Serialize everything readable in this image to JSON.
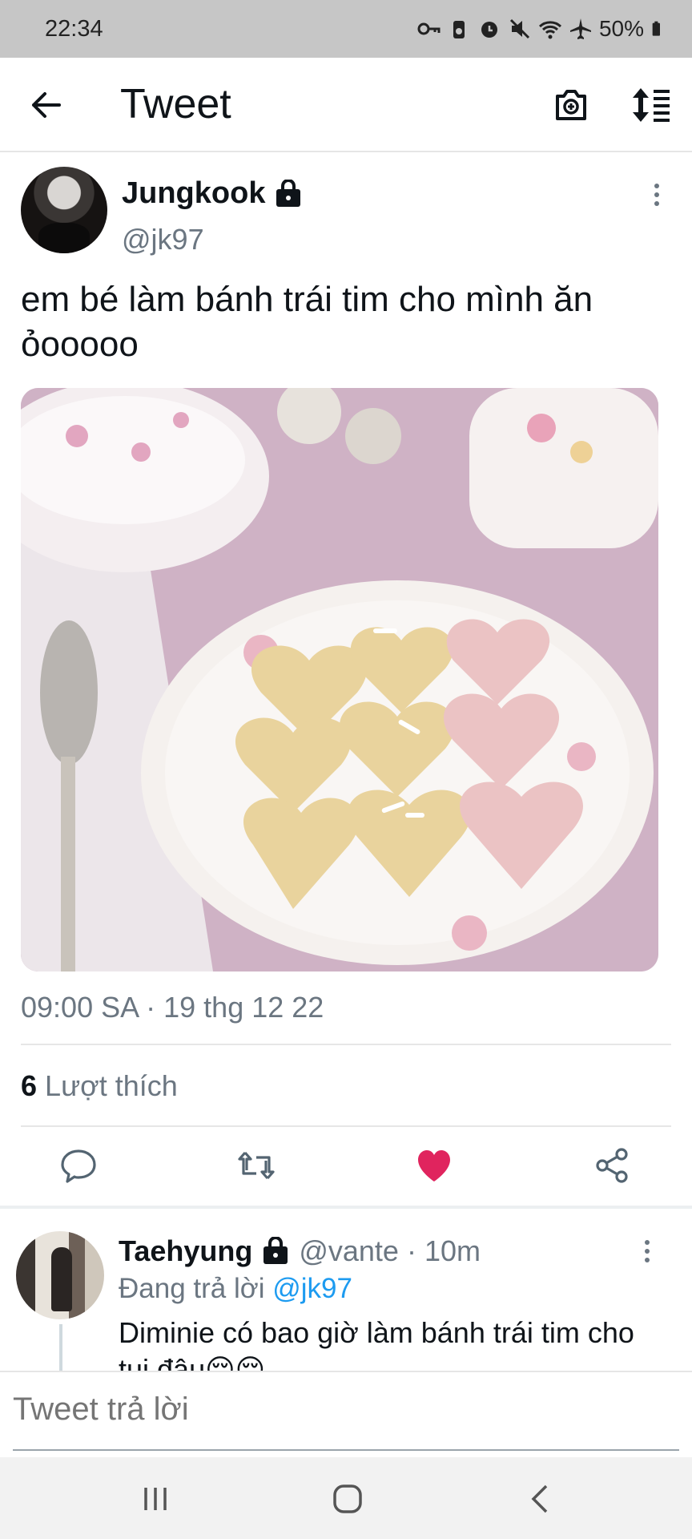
{
  "status_bar": {
    "time": "22:34",
    "battery": "50%",
    "icons": [
      "key-icon",
      "battery-saver-icon",
      "alarm-icon",
      "mute-icon",
      "wifi-icon",
      "airplane-icon",
      "battery-icon"
    ]
  },
  "header": {
    "title": "Tweet",
    "icons": [
      "back-arrow-icon",
      "camera-icon",
      "sort-icon"
    ]
  },
  "tweet": {
    "author_name": "Jungkook",
    "author_handle": "@jk97",
    "protected": true,
    "text": "em bé làm bánh trái tim cho mình ăn ỏooooo",
    "image_description_icon": "heart-cookies-photo",
    "timestamp": "09:00 SA · 19 thg 12 22",
    "likes_count": "6",
    "likes_label": "Lượt thích",
    "liked": true,
    "accent_color": "#e0245e"
  },
  "reply": {
    "author_name": "Taehyung",
    "protected": true,
    "meta": "@vante · 10m",
    "replying_prefix": "Đang trả lời",
    "replying_to": "@jk97",
    "text": "Diminie có bao giờ làm bánh trái tim cho tui đâu😔😔"
  },
  "compose": {
    "placeholder": "Tweet trả lời"
  },
  "colors": {
    "link": "#1d9bf0",
    "secondary_text": "#6b7681",
    "status_bar_bg": "#c6c6c6"
  }
}
